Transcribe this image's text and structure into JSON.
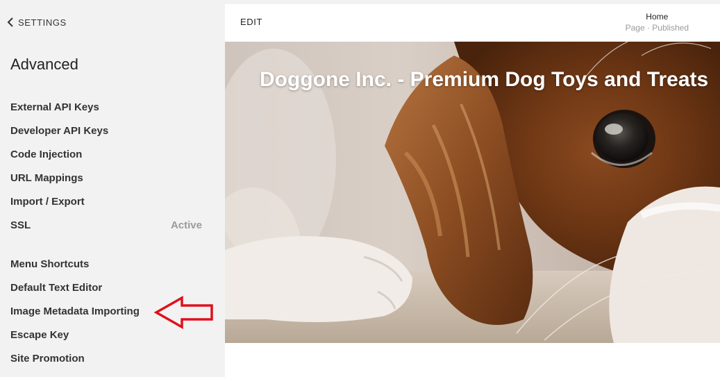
{
  "sidebar": {
    "back_label": "SETTINGS",
    "title": "Advanced",
    "items": [
      {
        "label": "External API Keys",
        "status": ""
      },
      {
        "label": "Developer API Keys",
        "status": ""
      },
      {
        "label": "Code Injection",
        "status": ""
      },
      {
        "label": "URL Mappings",
        "status": ""
      },
      {
        "label": "Import / Export",
        "status": ""
      },
      {
        "label": "SSL",
        "status": "Active"
      },
      {
        "label": "Menu Shortcuts",
        "status": ""
      },
      {
        "label": "Default Text Editor",
        "status": ""
      },
      {
        "label": "Image Metadata Importing",
        "status": ""
      },
      {
        "label": "Escape Key",
        "status": ""
      },
      {
        "label": "Site Promotion",
        "status": ""
      }
    ]
  },
  "preview": {
    "edit_label": "EDIT",
    "page_name": "Home",
    "page_status": "Page · Published",
    "hero_title": "Doggone Inc. - Premium Dog Toys and Treats"
  },
  "icons": {
    "back": "chevron-left-icon",
    "annotation": "red-arrow-left-icon"
  },
  "colors": {
    "sidebar_bg": "#f2f2f2",
    "annotation_red": "#e0101c",
    "status_gray": "#9a9a9a"
  }
}
